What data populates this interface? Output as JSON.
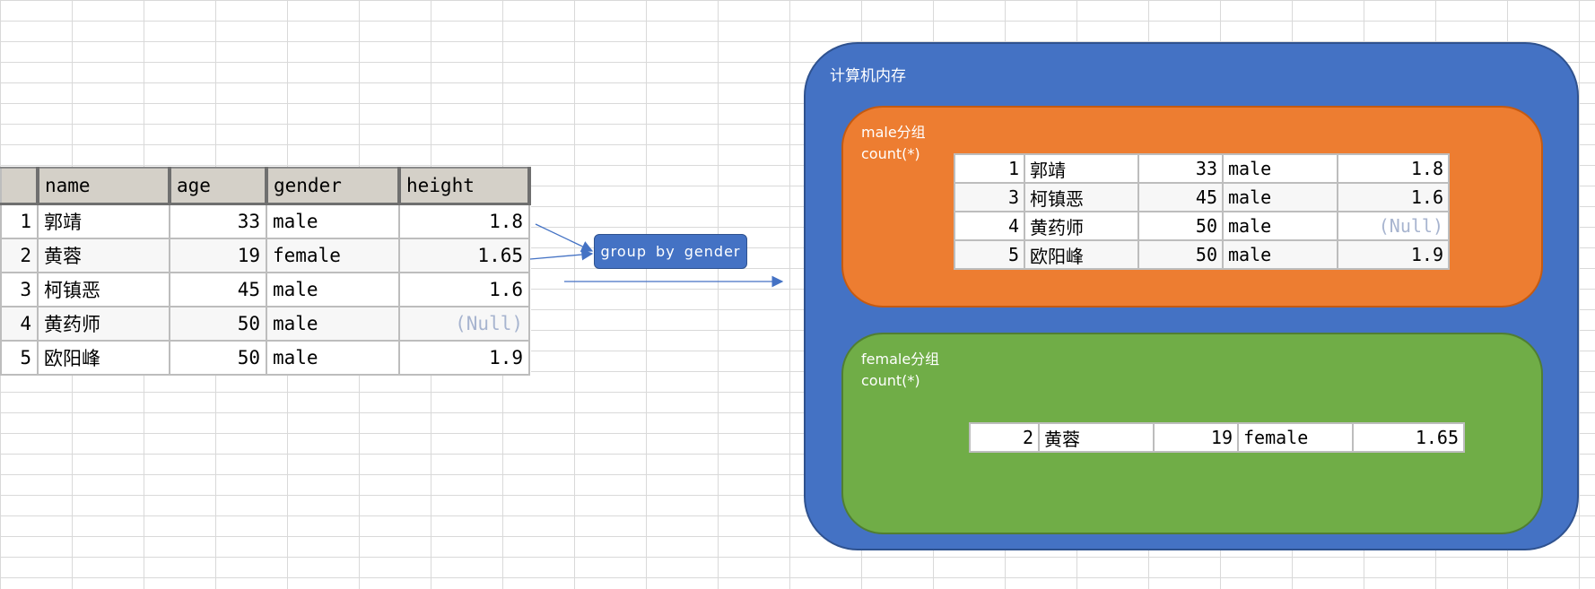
{
  "source_table": {
    "headers": [
      "name",
      "age",
      "gender",
      "height"
    ],
    "rows": [
      {
        "row": "1",
        "name": "郭靖",
        "age": "33",
        "gender": "male",
        "height": "1.8"
      },
      {
        "row": "2",
        "name": "黄蓉",
        "age": "19",
        "gender": "female",
        "height": "1.65"
      },
      {
        "row": "3",
        "name": "柯镇恶",
        "age": "45",
        "gender": "male",
        "height": "1.6"
      },
      {
        "row": "4",
        "name": "黄药师",
        "age": "50",
        "gender": "male",
        "height": "(Null)"
      },
      {
        "row": "5",
        "name": "欧阳峰",
        "age": "50",
        "gender": "male",
        "height": "1.9"
      }
    ]
  },
  "operation_label": "group by gender",
  "memory": {
    "title": "计算机内存",
    "male_group": {
      "title": "male分组",
      "aggregate": "count(*)",
      "rows": [
        {
          "row": "1",
          "name": "郭靖",
          "age": "33",
          "gender": "male",
          "height": "1.8"
        },
        {
          "row": "3",
          "name": "柯镇恶",
          "age": "45",
          "gender": "male",
          "height": "1.6"
        },
        {
          "row": "4",
          "name": "黄药师",
          "age": "50",
          "gender": "male",
          "height": "(Null)"
        },
        {
          "row": "5",
          "name": "欧阳峰",
          "age": "50",
          "gender": "male",
          "height": "1.9"
        }
      ]
    },
    "female_group": {
      "title": "female分组",
      "aggregate": "count(*)",
      "rows": [
        {
          "row": "2",
          "name": "黄蓉",
          "age": "19",
          "gender": "female",
          "height": "1.65"
        }
      ]
    }
  },
  "colors": {
    "memory": "#4472c4",
    "male_group": "#ed7d31",
    "female_group": "#70ad47",
    "header_bg": "#d4d0c8",
    "null_text": "#a7b4cf"
  }
}
